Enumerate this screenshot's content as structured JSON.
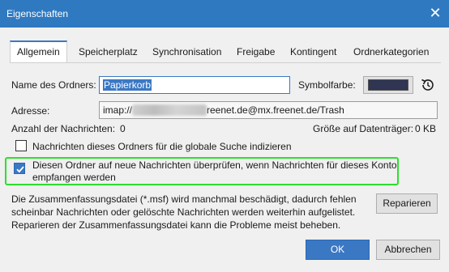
{
  "window": {
    "title": "Eigenschaften",
    "close_glyph": "✕"
  },
  "tabs": [
    {
      "label": "Allgemein",
      "active": true
    },
    {
      "label": "Speicherplatz"
    },
    {
      "label": "Synchronisation"
    },
    {
      "label": "Freigabe"
    },
    {
      "label": "Kontingent"
    },
    {
      "label": "Ordnerkategorien"
    }
  ],
  "general": {
    "folder_name_label": "Name des Ordners:",
    "folder_name_value": "Papierkorb",
    "symbol_color_label": "Symbolfarbe:",
    "symbol_color": "#2f3552",
    "address_label": "Adresse:",
    "address_prefix": "imap://",
    "address_suffix": "reenet.de@mx.freenet.de/Trash",
    "message_count_label": "Anzahl der Nachrichten:",
    "message_count_value": "0",
    "disk_size_label": "Größe auf Datenträger:",
    "disk_size_value": "0 KB",
    "global_search_checkbox": {
      "label": "Nachrichten dieses Ordners für die globale Suche indizieren",
      "checked": false
    },
    "check_new_checkbox": {
      "label_line1": "Diesen Ordner auf neue Nachrichten überprüfen, wenn Nachrichten für dieses Konto",
      "label_line2": "empfangen werden",
      "checked": true
    },
    "repair_text": [
      "Die Zusammenfassungsdatei (*.msf) wird manchmal beschädigt, dadurch fehlen",
      "scheinbar Nachrichten oder gelöschte Nachrichten werden weiterhin aufgelistet.",
      "Reparieren der Zusammenfassungsdatei kann die Probleme meist beheben."
    ],
    "repair_button": "Reparieren"
  },
  "buttons": {
    "ok": "OK",
    "cancel": "Abbrechen"
  },
  "colors": {
    "accent": "#3b78c4",
    "titlebar": "#2f79c1",
    "highlight": "#2ce02c"
  }
}
